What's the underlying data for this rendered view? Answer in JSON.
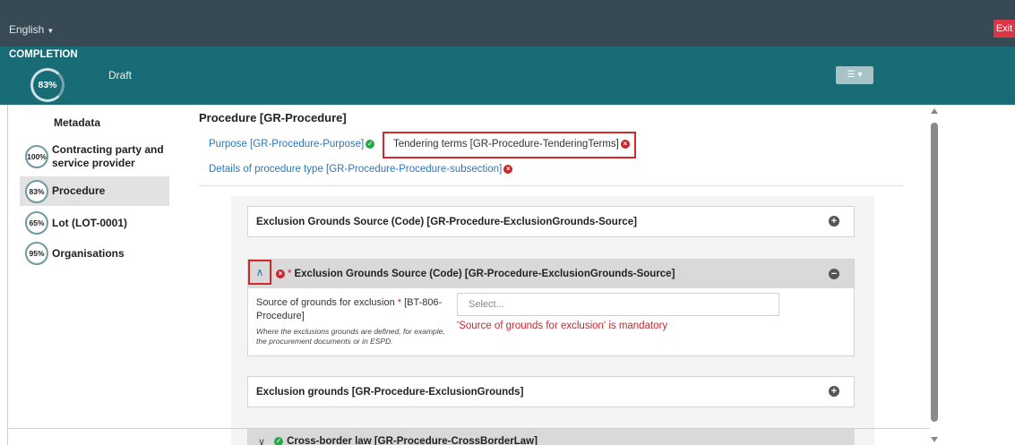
{
  "topbar": {
    "language": "English",
    "exit_label": "Exit"
  },
  "completion": {
    "title": "COMPLETION",
    "percent": "83%",
    "status": "Draft",
    "tools_icon": "sliders-icon"
  },
  "sidebar": {
    "title": "Metadata",
    "items": [
      {
        "percent": "100%",
        "label": "Contracting party and service provider"
      },
      {
        "percent": "83%",
        "label": "Procedure"
      },
      {
        "percent": "65%",
        "label": "Lot (LOT-0001)"
      },
      {
        "percent": "95%",
        "label": "Organisations"
      }
    ]
  },
  "main": {
    "title": "Procedure [GR-Procedure]",
    "tabs": [
      {
        "label": "Purpose  [GR-Procedure-Purpose]",
        "status": "ok"
      },
      {
        "label": "Tendering terms  [GR-Procedure-TenderingTerms]",
        "status": "error"
      },
      {
        "label": "Details of procedure type  [GR-Procedure-Procedure-subsection]",
        "status": "error"
      }
    ],
    "sections": {
      "s1": {
        "title": "Exclusion Grounds Source (Code)  [GR-Procedure-ExclusionGrounds-Source]"
      },
      "s2": {
        "required_mark": "*",
        "title": "Exclusion Grounds Source (Code)  [GR-Procedure-ExclusionGrounds-Source]",
        "field_label_a": "Source of grounds for exclusion",
        "field_required": "*",
        "field_label_b": " [BT-806-Procedure]",
        "field_hint": "Where the exclusions grounds are defined, for example, the procurement documents or in ESPD.",
        "select_placeholder": "Select...",
        "error_message": "'Source of grounds for exclusion' is mandatory"
      },
      "s3": {
        "title": "Exclusion grounds  [GR-Procedure-ExclusionGrounds]"
      },
      "s4": {
        "title": "Cross-border law  [GR-Procedure-CrossBorderLaw]"
      }
    }
  }
}
